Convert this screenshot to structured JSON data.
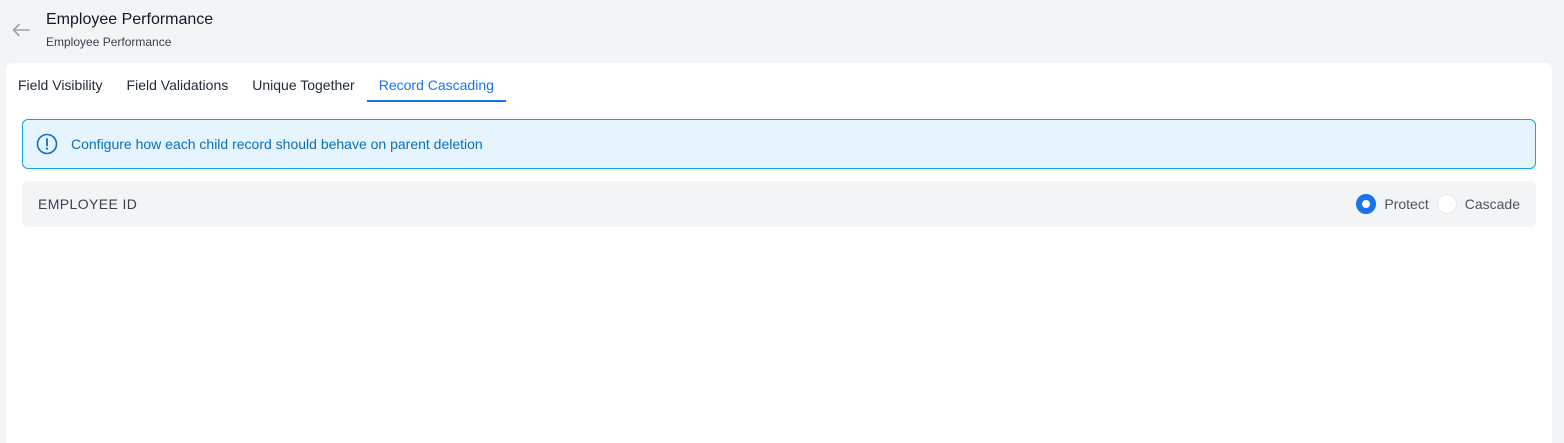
{
  "header": {
    "title": "Employee Performance",
    "subtitle": "Employee Performance",
    "back_icon": "arrow-left-icon"
  },
  "tabs": [
    {
      "label": "Field Visibility",
      "active": false
    },
    {
      "label": "Field Validations",
      "active": false
    },
    {
      "label": "Unique Together",
      "active": false
    },
    {
      "label": "Record Cascading",
      "active": true
    }
  ],
  "info_banner": {
    "icon": "info-circle-icon",
    "text": "Configure how each child record should behave on parent deletion"
  },
  "cascade_rows": [
    {
      "field": "EMPLOYEE ID",
      "options": [
        {
          "label": "Protect",
          "selected": true
        },
        {
          "label": "Cascade",
          "selected": false
        }
      ]
    }
  ],
  "colors": {
    "accent": "#1a73e8",
    "banner_bg": "#e5f4fd",
    "banner_border": "#0ea5e9",
    "banner_text": "#0a6fbf",
    "page_bg": "#f3f4f6"
  }
}
